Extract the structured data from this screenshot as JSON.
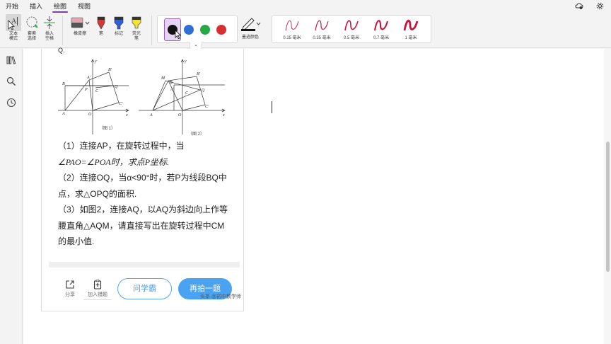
{
  "menu": {
    "items": [
      "开始",
      "插入",
      "绘图",
      "视图"
    ],
    "active_index": 2
  },
  "ribbon": {
    "text_mode": "文本\n模式",
    "lasso": "套索\n选择",
    "insert_space": "插入\n空格",
    "eraser": "橡皮擦",
    "pen": "笔",
    "marker": "标记",
    "highlighter": "荧光\n笔",
    "edge_color": "墨迹颜色",
    "colors": [
      "#111111",
      "#2f6fd6",
      "#2aa845",
      "#d62f2f"
    ],
    "selected_color_index": 0,
    "thickness": [
      "0.25 毫米",
      "0.35 毫米",
      "0.5 毫米",
      "0.7 毫米",
      "1 毫米"
    ],
    "ink_color": "#c8143c"
  },
  "question": {
    "title_fragment": "Q.",
    "figure1_caption": "（图 1）",
    "figure2_caption": "（图 2）",
    "lines": [
      "（1）连接AP，在旋转过程中，当",
      "∠PAO=∠POA时，求点P坐标.",
      "（2）连接OQ，当α<90°时，若P为线段BQ中",
      "点，求△OPQ的面积.",
      "（3）如图2，连接AQ，以AQ为斜边向上作等",
      "腰直角△AQM，请直接写出在旋转过程中CM",
      "的最小值."
    ]
  },
  "footer": {
    "share": "分享",
    "add_wrong": "加入错题",
    "ask": "问学霸",
    "retake": "再拍一题",
    "watermark": "头条 @初中数学师"
  }
}
